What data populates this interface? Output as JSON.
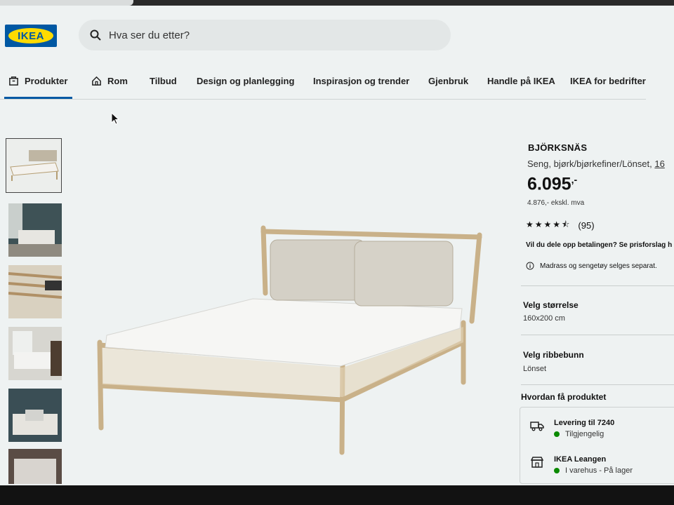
{
  "header": {
    "logo_text": "IKEA",
    "search_placeholder": "Hva ser du etter?"
  },
  "nav": {
    "items": [
      {
        "label": "Produkter",
        "icon": "tag-icon"
      },
      {
        "label": "Rom",
        "icon": "home-icon"
      },
      {
        "label": "Tilbud"
      },
      {
        "label": "Design og planlegging"
      },
      {
        "label": "Inspirasjon og trender"
      },
      {
        "label": "Gjenbruk"
      },
      {
        "label": "Handle på IKEA"
      },
      {
        "label": "IKEA for bedrifter"
      }
    ]
  },
  "product": {
    "name": "BJÖRKSNÄS",
    "description": "Seng, bjørk/bjørkefiner/Lönset, ",
    "description_link": "16",
    "price": "6.095",
    "price_suffix": ",-",
    "price_ex_vat": "4.876,- ekskl. mva",
    "stars": "★★★★⯪",
    "rating": 4.5,
    "review_count": "(95)",
    "split_payment": "Vil du dele opp betalingen? Se prisforslag h",
    "note": "Madrass og sengetøy selges separat."
  },
  "options": {
    "size_title": "Velg størrelse",
    "size_value": "160x200 cm",
    "slats_title": "Velg ribbebunn",
    "slats_value": "Lönset",
    "how_title": "Hvordan få produktet"
  },
  "delivery": {
    "delivery_title": "Levering til 7240",
    "delivery_status": "Tilgjengelig",
    "store_title": "IKEA Leangen",
    "store_status": "I varehus - På lager",
    "status_color": "#0a8a00"
  },
  "colors": {
    "brand_blue": "#0058a3",
    "brand_yellow": "#ffdb00"
  }
}
